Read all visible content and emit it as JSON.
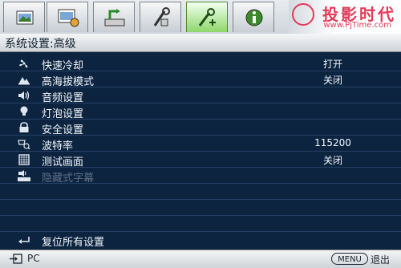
{
  "tabs": [
    {
      "icon": "picture-icon"
    },
    {
      "icon": "picture-advanced-icon"
    },
    {
      "icon": "source-icon"
    },
    {
      "icon": "system-setup-basic-icon"
    },
    {
      "icon": "system-setup-advanced-icon",
      "active": true
    },
    {
      "icon": "information-icon"
    }
  ],
  "watermark": {
    "text": "投影时代",
    "url": "www.PjTime.com"
  },
  "header": {
    "title": "系统设置:高级"
  },
  "menu": {
    "items": [
      {
        "label": "快速冷却",
        "value": "打开",
        "icon": "fan-icon"
      },
      {
        "label": "高海拔模式",
        "value": "关闭",
        "icon": "mountain-icon"
      },
      {
        "label": "音频设置",
        "value": "",
        "icon": "speaker-icon"
      },
      {
        "label": "灯泡设置",
        "value": "",
        "icon": "lightbulb-icon"
      },
      {
        "label": "安全设置",
        "value": "",
        "icon": "lock-icon"
      },
      {
        "label": "波特率",
        "value": "115200",
        "icon": "serial-port-icon"
      },
      {
        "label": "测试画面",
        "value": "关闭",
        "icon": "test-pattern-icon"
      },
      {
        "label": "隐藏式字幕",
        "value": "",
        "icon": "closed-caption-icon",
        "disabled": true
      }
    ],
    "reset_label": "复位所有设置"
  },
  "footer": {
    "source": "PC",
    "menu_button": "MENU",
    "exit_label": "退出"
  }
}
